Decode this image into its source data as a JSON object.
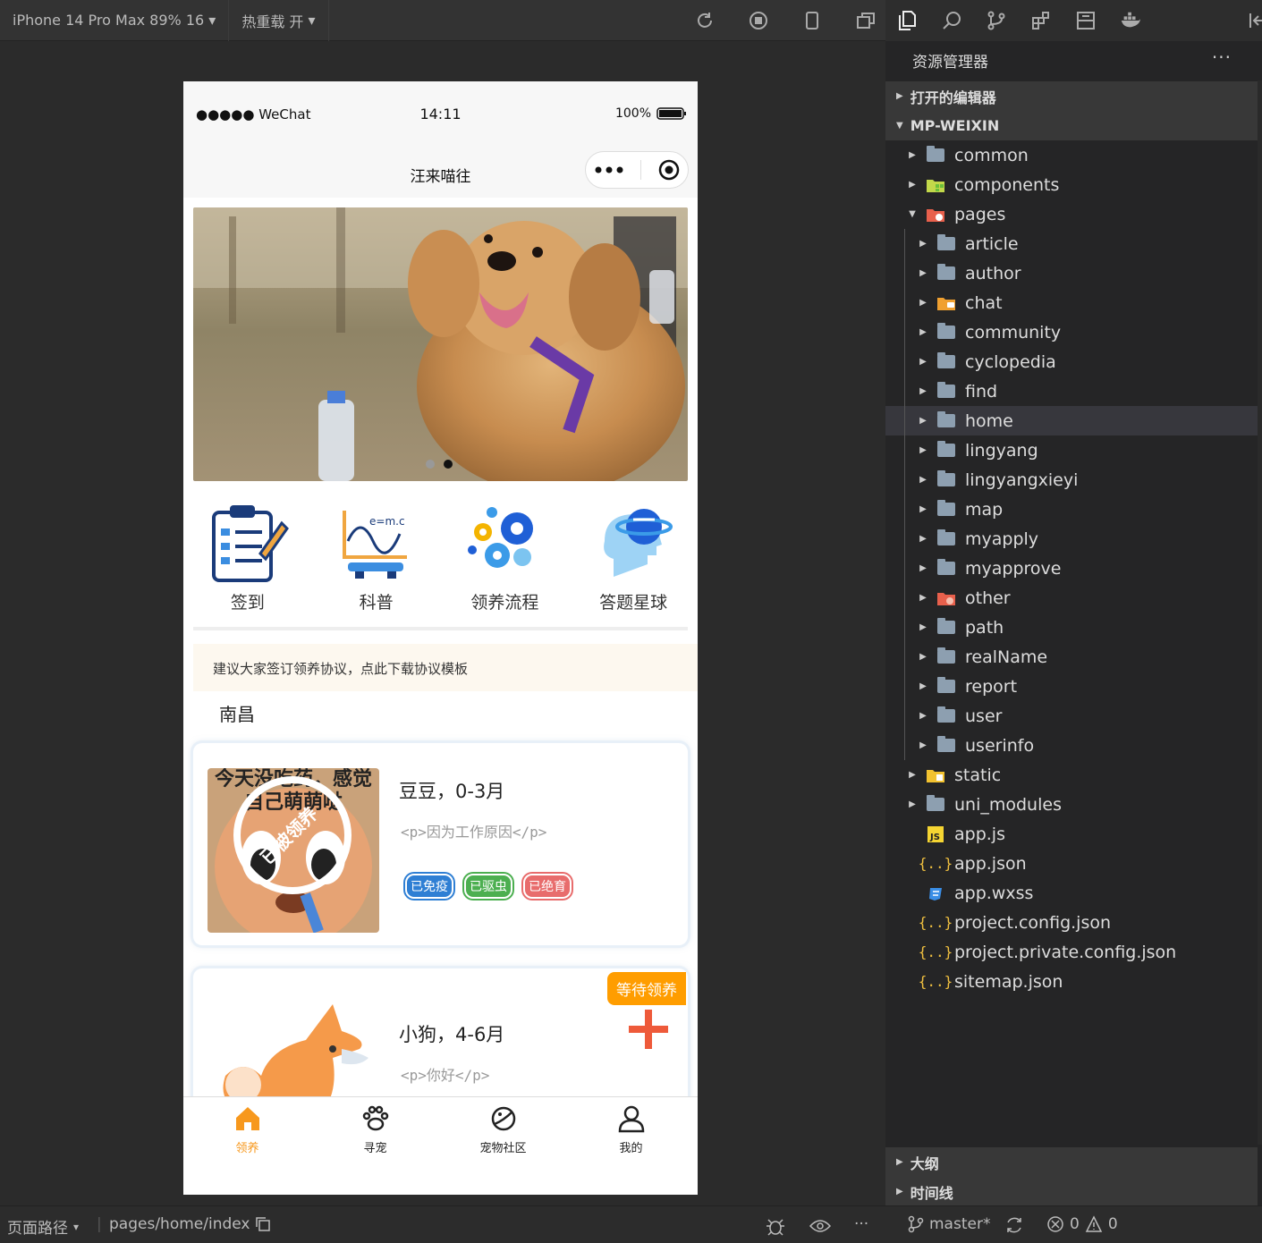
{
  "topbar": {
    "device": "iPhone 14 Pro Max 89% 16",
    "hotreload": "热重载 开"
  },
  "phone": {
    "status": {
      "signal": "●●●●● WeChat",
      "time": "14:11",
      "battery": "100%"
    },
    "nav_title": "汪来喵往",
    "banner": {
      "dots": 2,
      "active": 1
    },
    "grid": [
      {
        "label": "签到",
        "icon": "clipboard-icon"
      },
      {
        "label": "科普",
        "icon": "science-icon"
      },
      {
        "label": "领养流程",
        "icon": "gears-icon"
      },
      {
        "label": "答题星球",
        "icon": "planet-head-icon"
      }
    ],
    "notice": "建议大家签订领养协议，点此下载协议模板",
    "city": "南昌",
    "pets": [
      {
        "name": "豆豆，0-3月",
        "desc": "<p>因为工作原因</p>",
        "tags": [
          {
            "text": "已免疫",
            "color": "#2f7fd4"
          },
          {
            "text": "已驱虫",
            "color": "#4caf50"
          },
          {
            "text": "已绝育",
            "color": "#e86c6c"
          }
        ],
        "image_text": "今天没吃药，感觉自己萌萌哒",
        "stamp": "已被领养"
      },
      {
        "name": "小狗，4-6月",
        "desc": "<p>你好</p>",
        "ribbon": "等待领养"
      }
    ],
    "tabs": [
      {
        "label": "领养",
        "icon": "home-icon",
        "active": true
      },
      {
        "label": "寻宠",
        "icon": "paw-icon"
      },
      {
        "label": "宠物社区",
        "icon": "planet-icon"
      },
      {
        "label": "我的",
        "icon": "user-icon"
      }
    ]
  },
  "explorer": {
    "header": "资源管理器",
    "open_editors": "打开的编辑器",
    "project": "MP-WEIXIN",
    "items": [
      {
        "name": "common",
        "depth": 1,
        "type": "folder",
        "caret": "▶"
      },
      {
        "name": "components",
        "depth": 1,
        "type": "folder-components",
        "caret": "▶"
      },
      {
        "name": "pages",
        "depth": 1,
        "type": "folder-pages",
        "caret": "▼"
      },
      {
        "name": "article",
        "depth": 2,
        "type": "folder",
        "caret": "▶"
      },
      {
        "name": "author",
        "depth": 2,
        "type": "folder",
        "caret": "▶"
      },
      {
        "name": "chat",
        "depth": 2,
        "type": "folder-chat",
        "caret": "▶"
      },
      {
        "name": "community",
        "depth": 2,
        "type": "folder",
        "caret": "▶"
      },
      {
        "name": "cyclopedia",
        "depth": 2,
        "type": "folder",
        "caret": "▶"
      },
      {
        "name": "find",
        "depth": 2,
        "type": "folder",
        "caret": "▶"
      },
      {
        "name": "home",
        "depth": 2,
        "type": "folder",
        "caret": "▶",
        "selected": true
      },
      {
        "name": "lingyang",
        "depth": 2,
        "type": "folder",
        "caret": "▶"
      },
      {
        "name": "lingyangxieyi",
        "depth": 2,
        "type": "folder",
        "caret": "▶"
      },
      {
        "name": "map",
        "depth": 2,
        "type": "folder",
        "caret": "▶"
      },
      {
        "name": "myapply",
        "depth": 2,
        "type": "folder",
        "caret": "▶"
      },
      {
        "name": "myapprove",
        "depth": 2,
        "type": "folder",
        "caret": "▶"
      },
      {
        "name": "other",
        "depth": 2,
        "type": "folder-other",
        "caret": "▶"
      },
      {
        "name": "path",
        "depth": 2,
        "type": "folder",
        "caret": "▶"
      },
      {
        "name": "realName",
        "depth": 2,
        "type": "folder",
        "caret": "▶"
      },
      {
        "name": "report",
        "depth": 2,
        "type": "folder",
        "caret": "▶"
      },
      {
        "name": "user",
        "depth": 2,
        "type": "folder",
        "caret": "▶"
      },
      {
        "name": "userinfo",
        "depth": 2,
        "type": "folder",
        "caret": "▶"
      },
      {
        "name": "static",
        "depth": 1,
        "type": "folder-static",
        "caret": "▶"
      },
      {
        "name": "uni_modules",
        "depth": 1,
        "type": "folder",
        "caret": "▶"
      },
      {
        "name": "app.js",
        "depth": 1,
        "type": "js",
        "caret": ""
      },
      {
        "name": "app.json",
        "depth": 1,
        "type": "json",
        "caret": ""
      },
      {
        "name": "app.wxss",
        "depth": 1,
        "type": "css",
        "caret": ""
      },
      {
        "name": "project.config.json",
        "depth": 1,
        "type": "json",
        "caret": ""
      },
      {
        "name": "project.private.config.json",
        "depth": 1,
        "type": "json",
        "caret": ""
      },
      {
        "name": "sitemap.json",
        "depth": 1,
        "type": "json",
        "caret": ""
      }
    ],
    "outline": "大纲",
    "timeline": "时间线"
  },
  "statusbar": {
    "page_path_label": "页面路径",
    "page_path": "pages/home/index",
    "branch": "master*",
    "errors": "0",
    "warnings": "0"
  }
}
